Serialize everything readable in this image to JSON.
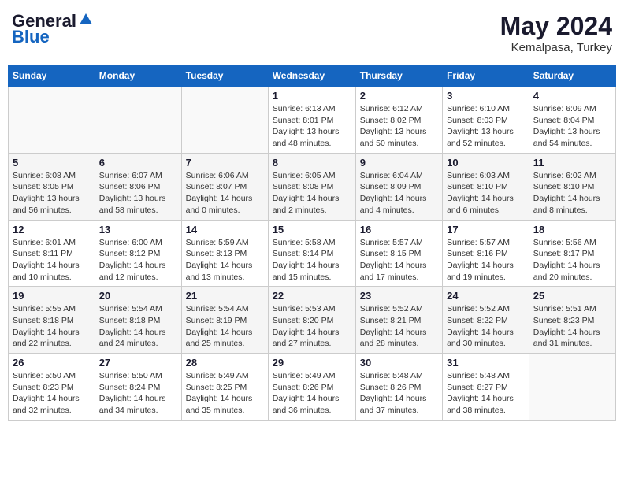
{
  "header": {
    "logo_general": "General",
    "logo_blue": "Blue",
    "title": "May 2024",
    "location": "Kemalpasa, Turkey"
  },
  "weekdays": [
    "Sunday",
    "Monday",
    "Tuesday",
    "Wednesday",
    "Thursday",
    "Friday",
    "Saturday"
  ],
  "weeks": [
    [
      {
        "day": "",
        "sunrise": "",
        "sunset": "",
        "daylight": ""
      },
      {
        "day": "",
        "sunrise": "",
        "sunset": "",
        "daylight": ""
      },
      {
        "day": "",
        "sunrise": "",
        "sunset": "",
        "daylight": ""
      },
      {
        "day": "1",
        "sunrise": "Sunrise: 6:13 AM",
        "sunset": "Sunset: 8:01 PM",
        "daylight": "Daylight: 13 hours and 48 minutes."
      },
      {
        "day": "2",
        "sunrise": "Sunrise: 6:12 AM",
        "sunset": "Sunset: 8:02 PM",
        "daylight": "Daylight: 13 hours and 50 minutes."
      },
      {
        "day": "3",
        "sunrise": "Sunrise: 6:10 AM",
        "sunset": "Sunset: 8:03 PM",
        "daylight": "Daylight: 13 hours and 52 minutes."
      },
      {
        "day": "4",
        "sunrise": "Sunrise: 6:09 AM",
        "sunset": "Sunset: 8:04 PM",
        "daylight": "Daylight: 13 hours and 54 minutes."
      }
    ],
    [
      {
        "day": "5",
        "sunrise": "Sunrise: 6:08 AM",
        "sunset": "Sunset: 8:05 PM",
        "daylight": "Daylight: 13 hours and 56 minutes."
      },
      {
        "day": "6",
        "sunrise": "Sunrise: 6:07 AM",
        "sunset": "Sunset: 8:06 PM",
        "daylight": "Daylight: 13 hours and 58 minutes."
      },
      {
        "day": "7",
        "sunrise": "Sunrise: 6:06 AM",
        "sunset": "Sunset: 8:07 PM",
        "daylight": "Daylight: 14 hours and 0 minutes."
      },
      {
        "day": "8",
        "sunrise": "Sunrise: 6:05 AM",
        "sunset": "Sunset: 8:08 PM",
        "daylight": "Daylight: 14 hours and 2 minutes."
      },
      {
        "day": "9",
        "sunrise": "Sunrise: 6:04 AM",
        "sunset": "Sunset: 8:09 PM",
        "daylight": "Daylight: 14 hours and 4 minutes."
      },
      {
        "day": "10",
        "sunrise": "Sunrise: 6:03 AM",
        "sunset": "Sunset: 8:10 PM",
        "daylight": "Daylight: 14 hours and 6 minutes."
      },
      {
        "day": "11",
        "sunrise": "Sunrise: 6:02 AM",
        "sunset": "Sunset: 8:10 PM",
        "daylight": "Daylight: 14 hours and 8 minutes."
      }
    ],
    [
      {
        "day": "12",
        "sunrise": "Sunrise: 6:01 AM",
        "sunset": "Sunset: 8:11 PM",
        "daylight": "Daylight: 14 hours and 10 minutes."
      },
      {
        "day": "13",
        "sunrise": "Sunrise: 6:00 AM",
        "sunset": "Sunset: 8:12 PM",
        "daylight": "Daylight: 14 hours and 12 minutes."
      },
      {
        "day": "14",
        "sunrise": "Sunrise: 5:59 AM",
        "sunset": "Sunset: 8:13 PM",
        "daylight": "Daylight: 14 hours and 13 minutes."
      },
      {
        "day": "15",
        "sunrise": "Sunrise: 5:58 AM",
        "sunset": "Sunset: 8:14 PM",
        "daylight": "Daylight: 14 hours and 15 minutes."
      },
      {
        "day": "16",
        "sunrise": "Sunrise: 5:57 AM",
        "sunset": "Sunset: 8:15 PM",
        "daylight": "Daylight: 14 hours and 17 minutes."
      },
      {
        "day": "17",
        "sunrise": "Sunrise: 5:57 AM",
        "sunset": "Sunset: 8:16 PM",
        "daylight": "Daylight: 14 hours and 19 minutes."
      },
      {
        "day": "18",
        "sunrise": "Sunrise: 5:56 AM",
        "sunset": "Sunset: 8:17 PM",
        "daylight": "Daylight: 14 hours and 20 minutes."
      }
    ],
    [
      {
        "day": "19",
        "sunrise": "Sunrise: 5:55 AM",
        "sunset": "Sunset: 8:18 PM",
        "daylight": "Daylight: 14 hours and 22 minutes."
      },
      {
        "day": "20",
        "sunrise": "Sunrise: 5:54 AM",
        "sunset": "Sunset: 8:18 PM",
        "daylight": "Daylight: 14 hours and 24 minutes."
      },
      {
        "day": "21",
        "sunrise": "Sunrise: 5:54 AM",
        "sunset": "Sunset: 8:19 PM",
        "daylight": "Daylight: 14 hours and 25 minutes."
      },
      {
        "day": "22",
        "sunrise": "Sunrise: 5:53 AM",
        "sunset": "Sunset: 8:20 PM",
        "daylight": "Daylight: 14 hours and 27 minutes."
      },
      {
        "day": "23",
        "sunrise": "Sunrise: 5:52 AM",
        "sunset": "Sunset: 8:21 PM",
        "daylight": "Daylight: 14 hours and 28 minutes."
      },
      {
        "day": "24",
        "sunrise": "Sunrise: 5:52 AM",
        "sunset": "Sunset: 8:22 PM",
        "daylight": "Daylight: 14 hours and 30 minutes."
      },
      {
        "day": "25",
        "sunrise": "Sunrise: 5:51 AM",
        "sunset": "Sunset: 8:23 PM",
        "daylight": "Daylight: 14 hours and 31 minutes."
      }
    ],
    [
      {
        "day": "26",
        "sunrise": "Sunrise: 5:50 AM",
        "sunset": "Sunset: 8:23 PM",
        "daylight": "Daylight: 14 hours and 32 minutes."
      },
      {
        "day": "27",
        "sunrise": "Sunrise: 5:50 AM",
        "sunset": "Sunset: 8:24 PM",
        "daylight": "Daylight: 14 hours and 34 minutes."
      },
      {
        "day": "28",
        "sunrise": "Sunrise: 5:49 AM",
        "sunset": "Sunset: 8:25 PM",
        "daylight": "Daylight: 14 hours and 35 minutes."
      },
      {
        "day": "29",
        "sunrise": "Sunrise: 5:49 AM",
        "sunset": "Sunset: 8:26 PM",
        "daylight": "Daylight: 14 hours and 36 minutes."
      },
      {
        "day": "30",
        "sunrise": "Sunrise: 5:48 AM",
        "sunset": "Sunset: 8:26 PM",
        "daylight": "Daylight: 14 hours and 37 minutes."
      },
      {
        "day": "31",
        "sunrise": "Sunrise: 5:48 AM",
        "sunset": "Sunset: 8:27 PM",
        "daylight": "Daylight: 14 hours and 38 minutes."
      },
      {
        "day": "",
        "sunrise": "",
        "sunset": "",
        "daylight": ""
      }
    ]
  ]
}
